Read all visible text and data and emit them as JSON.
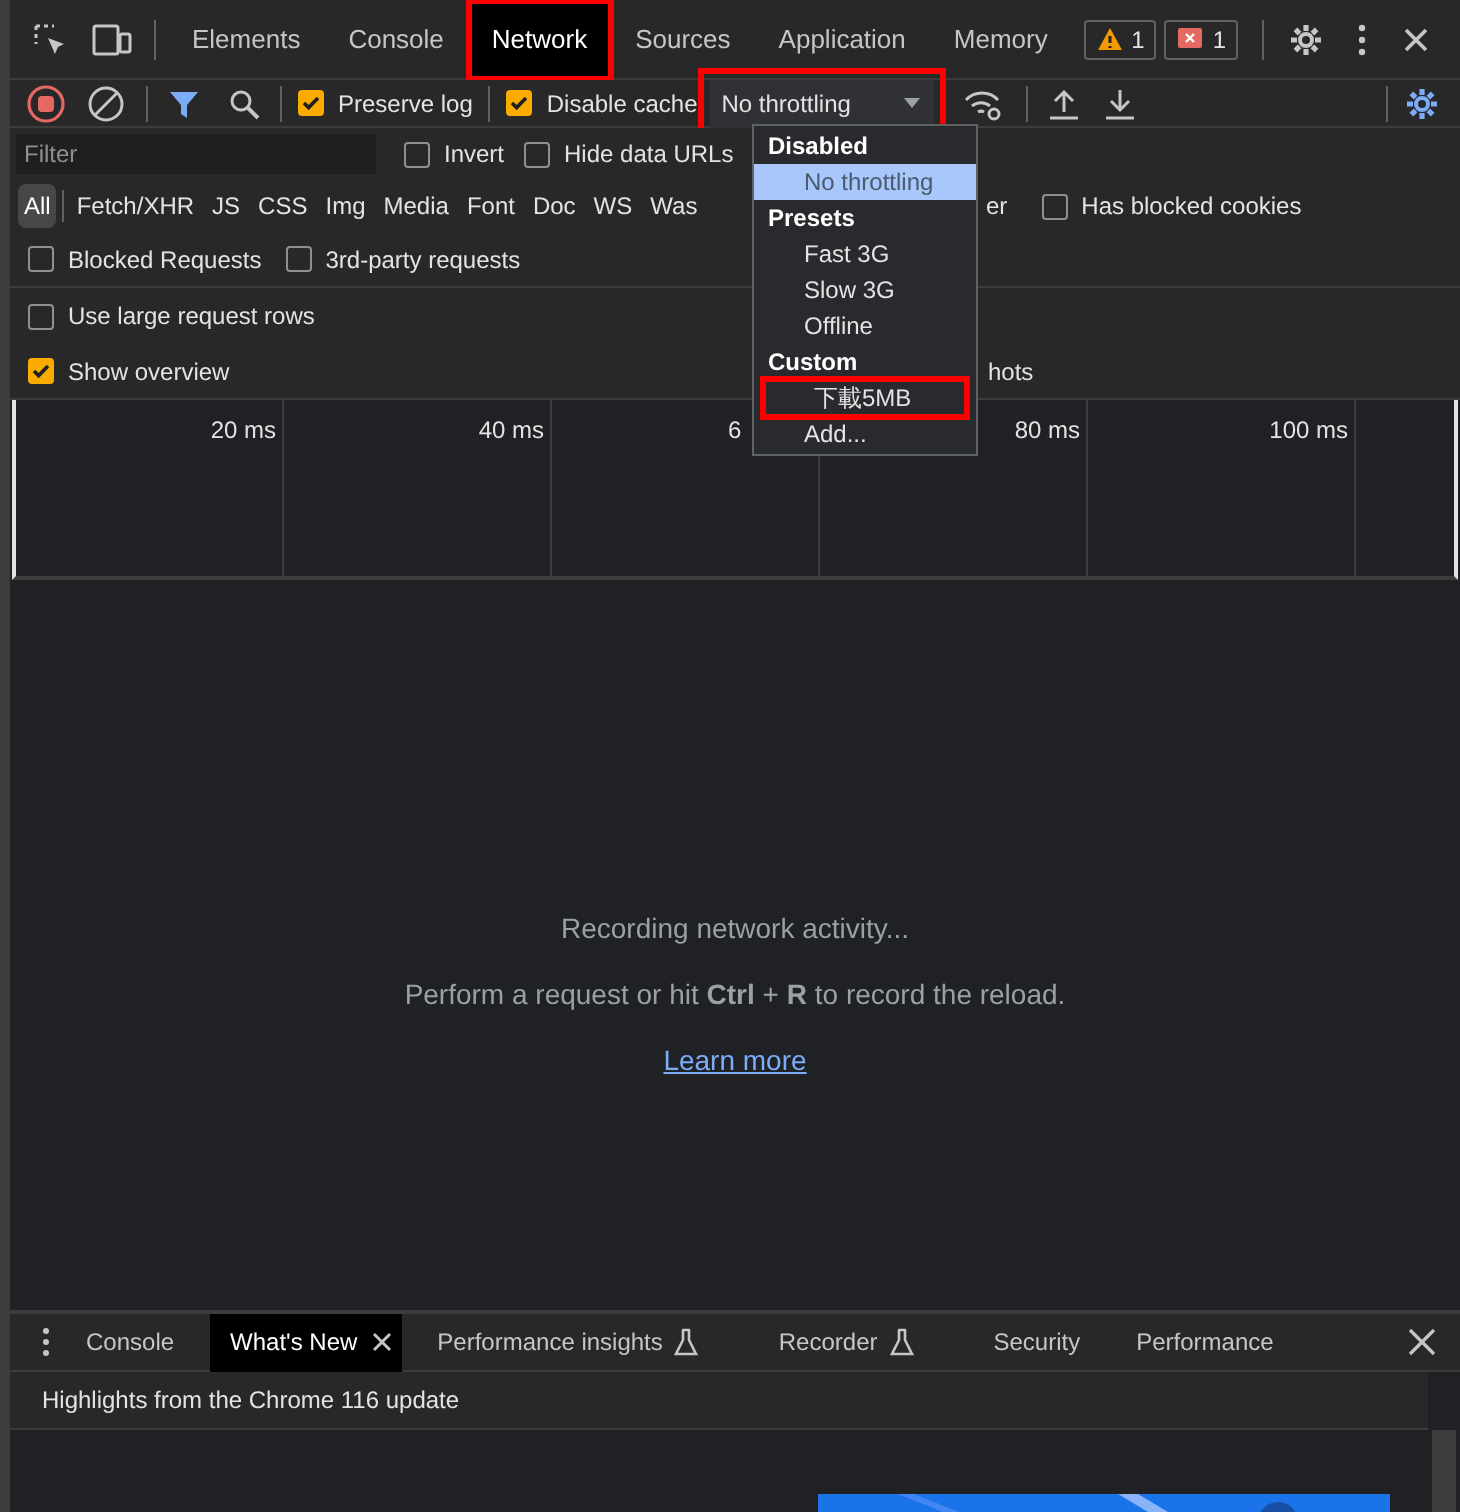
{
  "tabs": [
    {
      "label": "Elements",
      "selected": false,
      "annotated": false
    },
    {
      "label": "Console",
      "selected": false,
      "annotated": false
    },
    {
      "label": "Network",
      "selected": true,
      "annotated": true
    },
    {
      "label": "Sources",
      "selected": false,
      "annotated": false
    },
    {
      "label": "Application",
      "selected": false,
      "annotated": false
    },
    {
      "label": "Memory",
      "selected": false,
      "annotated": false
    }
  ],
  "badges": [
    {
      "kind": "warning",
      "count": "1"
    },
    {
      "kind": "error",
      "count": "1"
    }
  ],
  "toolbar": {
    "checkboxes": [
      {
        "label": "Preserve log",
        "checked": true
      },
      {
        "label": "Disable cache",
        "checked": true
      }
    ],
    "throttling": {
      "value": "No throttling",
      "annotated": true
    }
  },
  "filter": {
    "placeholder": "Filter",
    "options": [
      {
        "label": "Invert",
        "checked": false
      },
      {
        "label": "Hide data URLs",
        "checked": false
      }
    ]
  },
  "type_filters": [
    {
      "label": "All",
      "selected": true
    },
    {
      "label": "Fetch/XHR",
      "selected": false
    },
    {
      "label": "JS",
      "selected": false
    },
    {
      "label": "CSS",
      "selected": false
    },
    {
      "label": "Img",
      "selected": false
    },
    {
      "label": "Media",
      "selected": false
    },
    {
      "label": "Font",
      "selected": false
    },
    {
      "label": "Doc",
      "selected": false
    },
    {
      "label": "WS",
      "selected": false
    },
    {
      "label": "Was",
      "selected": false
    }
  ],
  "type_filters_after_menu": [
    {
      "label": "er",
      "selected": false
    }
  ],
  "blocked_cookies": {
    "label": "Has blocked cookies",
    "checked": false
  },
  "request_filters": [
    {
      "label": "Blocked Requests",
      "checked": false
    },
    {
      "label": "3rd-party requests",
      "checked": false
    }
  ],
  "settings": [
    {
      "label": "Use large request rows",
      "checked": false
    },
    {
      "label": "Show overview",
      "checked": true,
      "trailing": "hots"
    }
  ],
  "timeline": [
    "20 ms",
    "40 ms",
    "6",
    "80 ms",
    "100 ms"
  ],
  "empty_state": {
    "title": "Recording network activity...",
    "hint": "Perform a request or hit **Ctrl** + **R** to record the reload.",
    "link": "Learn more"
  },
  "throttling_menu": [
    {
      "kind": "header",
      "label": "Disabled"
    },
    {
      "kind": "item",
      "label": "No throttling",
      "selected": true,
      "annotated": false
    },
    {
      "kind": "header",
      "label": "Presets"
    },
    {
      "kind": "item",
      "label": "Fast 3G",
      "selected": false,
      "annotated": false
    },
    {
      "kind": "item",
      "label": "Slow 3G",
      "selected": false,
      "annotated": false
    },
    {
      "kind": "item",
      "label": "Offline",
      "selected": false,
      "annotated": false
    },
    {
      "kind": "header",
      "label": "Custom"
    },
    {
      "kind": "item",
      "label": "下載5MB",
      "selected": false,
      "annotated": true
    },
    {
      "kind": "item",
      "label": "Add...",
      "selected": false,
      "annotated": false
    }
  ],
  "drawer": {
    "tabs": [
      {
        "label": "Console",
        "selected": false,
        "closable": false,
        "experimental": false
      },
      {
        "label": "What's New",
        "selected": true,
        "closable": true,
        "experimental": false
      },
      {
        "label": "Performance insights",
        "selected": false,
        "closable": false,
        "experimental": true
      },
      {
        "label": "Recorder",
        "selected": false,
        "closable": false,
        "experimental": true
      },
      {
        "label": "Security",
        "selected": false,
        "closable": false,
        "experimental": false
      },
      {
        "label": "Performance",
        "selected": false,
        "closable": false,
        "experimental": false
      }
    ],
    "heading": "Highlights from the Chrome 116 update"
  }
}
